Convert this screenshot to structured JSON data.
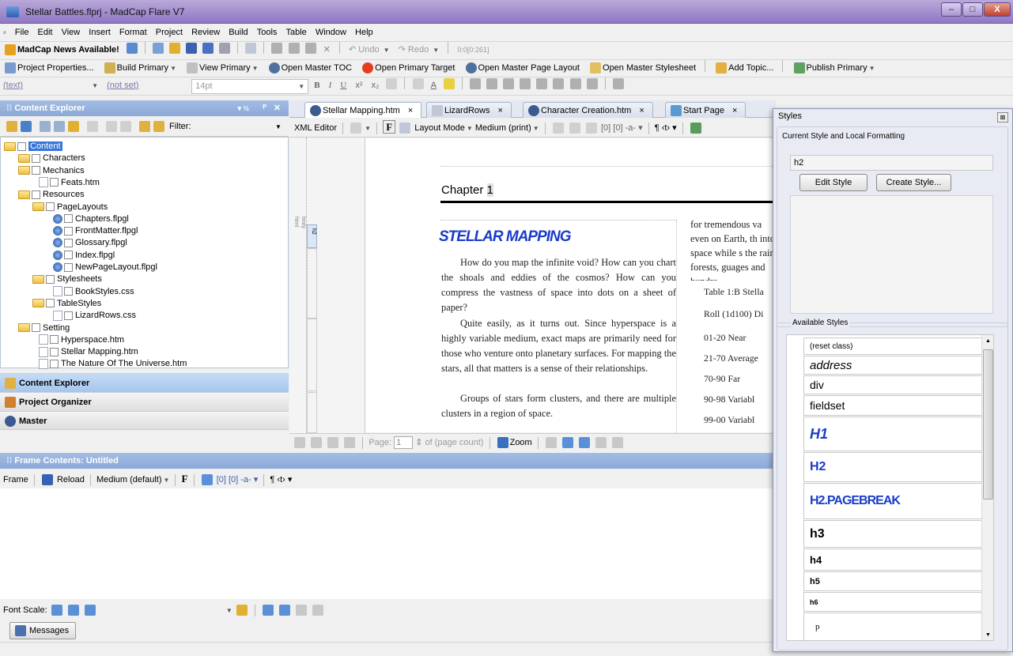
{
  "window": {
    "title": "Stellar Battles.flprj - MadCap Flare V7",
    "min": "‒",
    "max": "□",
    "close": "X"
  },
  "menu": [
    "File",
    "Edit",
    "View",
    "Insert",
    "Format",
    "Project",
    "Review",
    "Build",
    "Tools",
    "Table",
    "Window",
    "Help"
  ],
  "toolbar1": {
    "news": "MadCap News Available!",
    "undo": "Undo",
    "redo": "Redo",
    "position": "0:0[0:261]"
  },
  "toolbar2": {
    "project_properties": "Project Properties...",
    "build_primary": "Build Primary",
    "view_primary": "View Primary",
    "open_master_toc": "Open Master TOC",
    "open_primary_target": "Open Primary Target",
    "open_master_page_layout": "Open Master Page Layout",
    "open_master_stylesheet": "Open Master Stylesheet",
    "add_topic": "Add Topic...",
    "publish_primary": "Publish Primary"
  },
  "toolbar3": {
    "style": "(text)",
    "class": "(not set)",
    "size": "14pt"
  },
  "content_explorer": {
    "title": "Content Explorer",
    "filter_label": "Filter:",
    "tree": [
      {
        "label": "Content",
        "kind": "folder",
        "level": 0,
        "selected": true
      },
      {
        "label": "Characters",
        "kind": "folder",
        "level": 1
      },
      {
        "label": "Mechanics",
        "kind": "folder",
        "level": 1
      },
      {
        "label": "Feats.htm",
        "kind": "doc",
        "level": 2
      },
      {
        "label": "Resources",
        "kind": "folder",
        "level": 1
      },
      {
        "label": "PageLayouts",
        "kind": "folder",
        "level": 2
      },
      {
        "label": "Chapters.flpgl",
        "kind": "page",
        "level": 3
      },
      {
        "label": "FrontMatter.flpgl",
        "kind": "page",
        "level": 3
      },
      {
        "label": "Glossary.flpgl",
        "kind": "page",
        "level": 3
      },
      {
        "label": "Index.flpgl",
        "kind": "page",
        "level": 3
      },
      {
        "label": "NewPageLayout.flpgl",
        "kind": "page",
        "level": 3
      },
      {
        "label": "Stylesheets",
        "kind": "folder",
        "level": 2
      },
      {
        "label": "BookStyles.css",
        "kind": "doc",
        "level": 3
      },
      {
        "label": "TableStyles",
        "kind": "folder",
        "level": 2
      },
      {
        "label": "LizardRows.css",
        "kind": "doc",
        "level": 3
      },
      {
        "label": "Setting",
        "kind": "folder",
        "level": 1
      },
      {
        "label": "Hyperspace.htm",
        "kind": "doc",
        "level": 2
      },
      {
        "label": "Stellar Mapping.htm",
        "kind": "doc",
        "level": 2
      },
      {
        "label": "The Nature Of The Universe.htm",
        "kind": "doc",
        "level": 2
      }
    ],
    "accordion": [
      "Content Explorer",
      "Project Organizer",
      "Master"
    ]
  },
  "tabs": [
    "Stellar Mapping.htm",
    "LizardRows",
    "Character Creation.htm",
    "Start Page"
  ],
  "editor_toolbar": {
    "xml_editor": "XML Editor",
    "layout_mode": "Layout Mode",
    "medium": "Medium (print)"
  },
  "document": {
    "chapter": "Chapter",
    "chapter_num": "1",
    "heading": "STELLAR MAPPING",
    "para1": "How do you map the infinite void? How can you chart the shoals and eddies of the cosmos? How can you compress the vastness of space into dots on a sheet of paper?",
    "para2": "Quite easily, as it turns out. Since hyperspace is a highly variable medium, exact maps are primarily need for those who venture onto planetary surfaces. For mapping the stars, all that matters is a sense of their relationships.",
    "para3": "Groups of stars form clusters, and there are multiple clusters in a region of space.",
    "right_col": "for tremendous va even on Earth, th into space while s the rain forests, guages and hundre",
    "table_rows": [
      "Table 1:B Stella",
      "Roll (1d100) Di",
      "01-20 Near",
      "21-70 Average",
      "70-90 Far",
      "90-98 Variabl",
      "99-00 Variabl"
    ],
    "tag_html": "html",
    "tag_body": "body",
    "tag_h2": "h2"
  },
  "pager": {
    "page_label": "Page:",
    "page_value": "1",
    "page_count": "of (page count)",
    "zoom": "Zoom"
  },
  "frame": {
    "title": "Frame Contents: Untitled",
    "frame": "Frame",
    "reload": "Reload",
    "medium": "Medium (default)",
    "font_scale": "Font Scale:",
    "messages": "Messages"
  },
  "styles": {
    "title": "Styles",
    "current_label": "Current Style and Local Formatting",
    "current_value": "h2",
    "edit_style": "Edit Style",
    "create_style": "Create Style...",
    "available_label": "Available Styles",
    "items": [
      "(reset class)",
      "address",
      "div",
      "fieldset",
      "H1",
      "H2",
      "H2.PAGEBREAK",
      "h3",
      "h4",
      "h5",
      "h6",
      "p"
    ]
  }
}
